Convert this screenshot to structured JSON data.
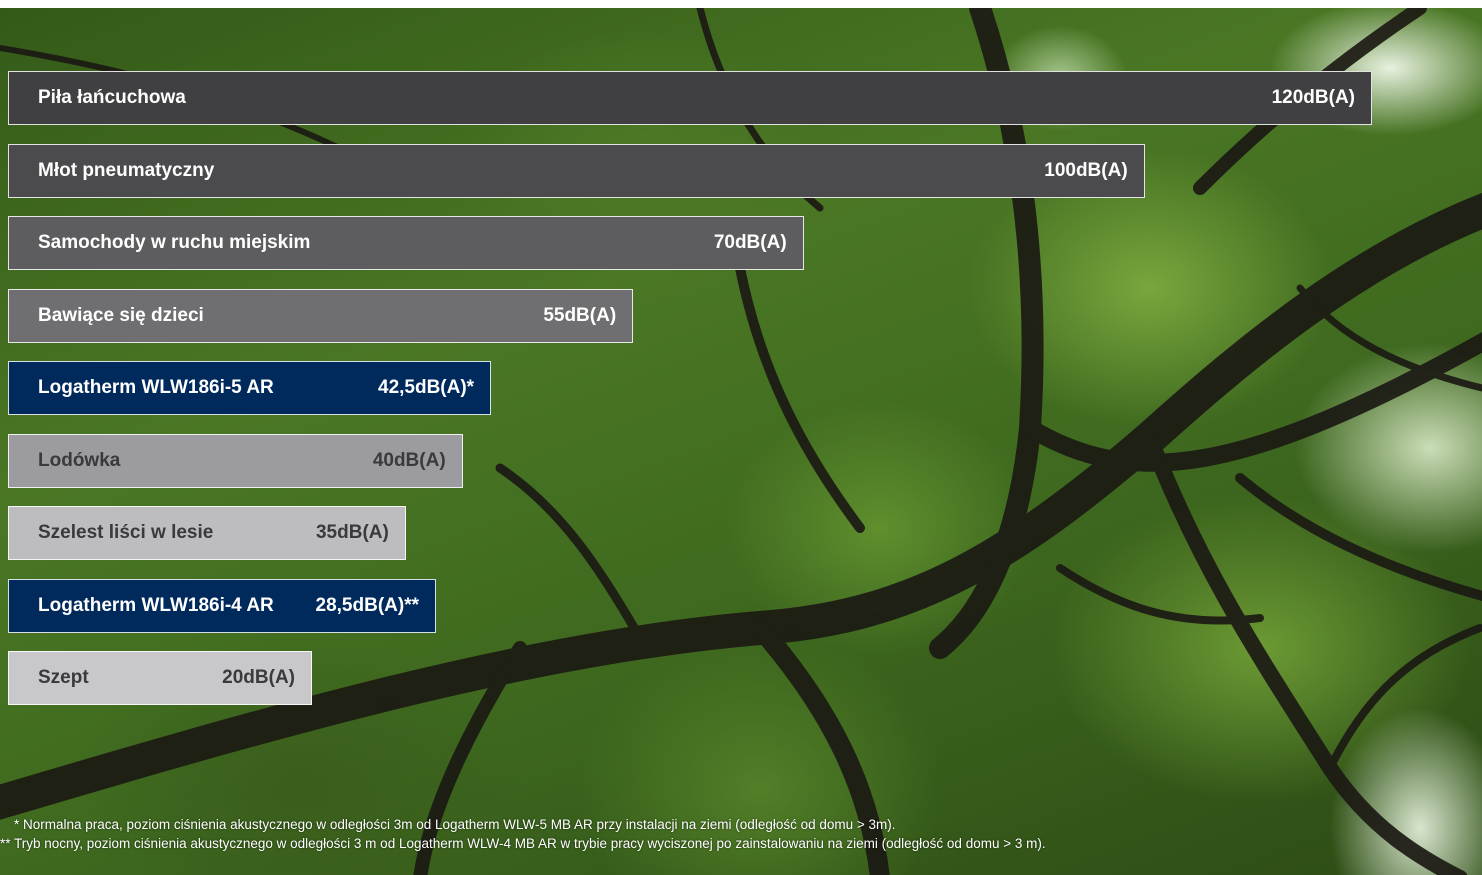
{
  "chart_data": {
    "type": "bar",
    "orientation": "horizontal",
    "unit": "dB(A)",
    "categories": [
      "Piła łańcuchowa",
      "Młot pneumatyczny",
      "Samochody w ruchu miejskim",
      "Bawiące się dzieci",
      "Logatherm WLW186i-5 AR",
      "Lodówka",
      "Szelest liści w lesie",
      "Logatherm WLW186i-4 AR",
      "Szept"
    ],
    "values": [
      120,
      100,
      70,
      55,
      42.5,
      40,
      35,
      28.5,
      20
    ],
    "value_labels": [
      "120dB(A)",
      "100dB(A)",
      "70dB(A)",
      "55dB(A)",
      "42,5dB(A)*",
      "40dB(A)",
      "35dB(A)",
      "28,5dB(A)**",
      "20dB(A)"
    ],
    "bar_colors": [
      "#404042",
      "#4b4b4d",
      "#5d5d5f",
      "#6f6f71",
      "#00295c",
      "#9c9ca0",
      "#bdbdc0",
      "#00295c",
      "#c8c8ca"
    ],
    "label_colors": [
      "#ffffff",
      "#ffffff",
      "#ffffff",
      "#ffffff",
      "#ffffff",
      "#3a3a3c",
      "#3a3a3c",
      "#ffffff",
      "#3a3a3c"
    ],
    "title": "",
    "xlabel": "",
    "ylabel": "",
    "grid": false
  },
  "footnotes": {
    "note1": "* Normalna praca, poziom ciśnienia akustycznego w odległości 3m od Logatherm WLW-5 MB AR przy instalacji na ziemi (odległość od domu > 3m).",
    "note2": "** Tryb nocny, poziom ciśnienia akustycznego w odległości 3 m od Logatherm WLW-4 MB AR w trybie pracy wyciszonej po zainstalowaniu na ziemi (odległość od domu > 3 m)."
  }
}
